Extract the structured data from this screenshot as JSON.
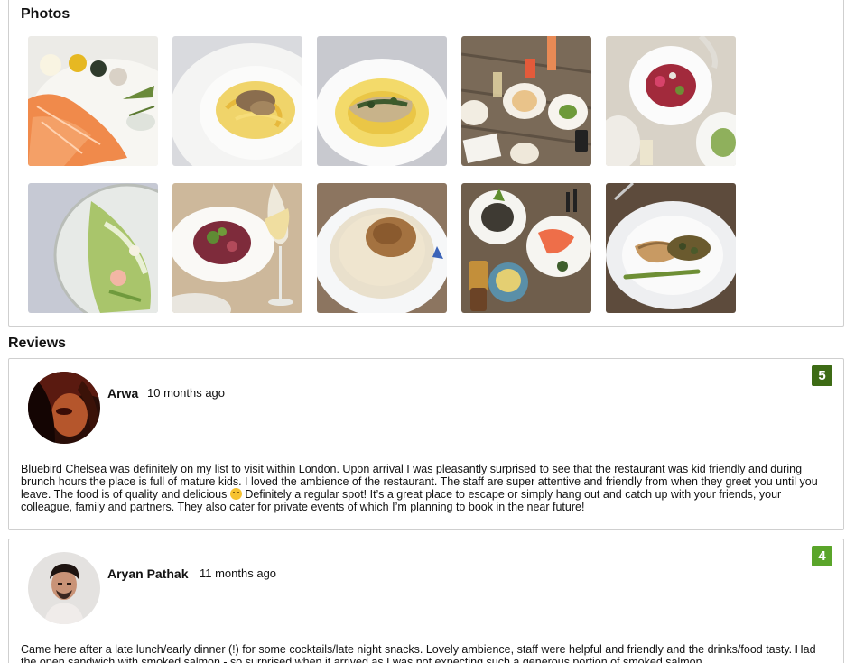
{
  "photos": {
    "title": "Photos",
    "items": [
      {
        "name": "photo-salmon-platter"
      },
      {
        "name": "photo-truffle-pasta"
      },
      {
        "name": "photo-fish-in-sauce"
      },
      {
        "name": "photo-table-spread"
      },
      {
        "name": "photo-beet-salad"
      },
      {
        "name": "photo-green-salad-bowl"
      },
      {
        "name": "photo-radicchio-salad-wine"
      },
      {
        "name": "photo-risotto-crumble"
      },
      {
        "name": "photo-table-spread-2"
      },
      {
        "name": "photo-seabass-asparagus"
      }
    ]
  },
  "reviews": {
    "title": "Reviews",
    "items": [
      {
        "author": "Arwa",
        "time": "10 months ago",
        "rating": "5",
        "rating_color": "#3d6b15",
        "text_before_emoji": "Bluebird Chelsea was definitely on my list to visit within London. Upon arrival I was pleasantly surprised to see that the restaurant was kid friendly and during brunch hours the place is full of mature kids. I loved the ambience of the restaurant. The staff are super attentive and friendly from when they greet you until you leave. The food is of quality and delicious",
        "text_after_emoji": " Definitely a regular spot! It’s a great place to escape or simply hang out and catch up with your friends, your colleague, family and partners. They also cater for private events of which I’m planning to book in the near future!"
      },
      {
        "author": "Aryan Pathak",
        "time": "11 months ago",
        "rating": "4",
        "rating_color": "#5aa52a",
        "text": "Came here after a late lunch/early dinner (!) for some cocktails/late night snacks. Lovely ambience, staff were helpful and friendly and the drinks/food tasty. Had the open sandwich with smoked salmon - so surprised when it arrived as I was not expecting such a generous portion of smoked salmon"
      }
    ]
  }
}
